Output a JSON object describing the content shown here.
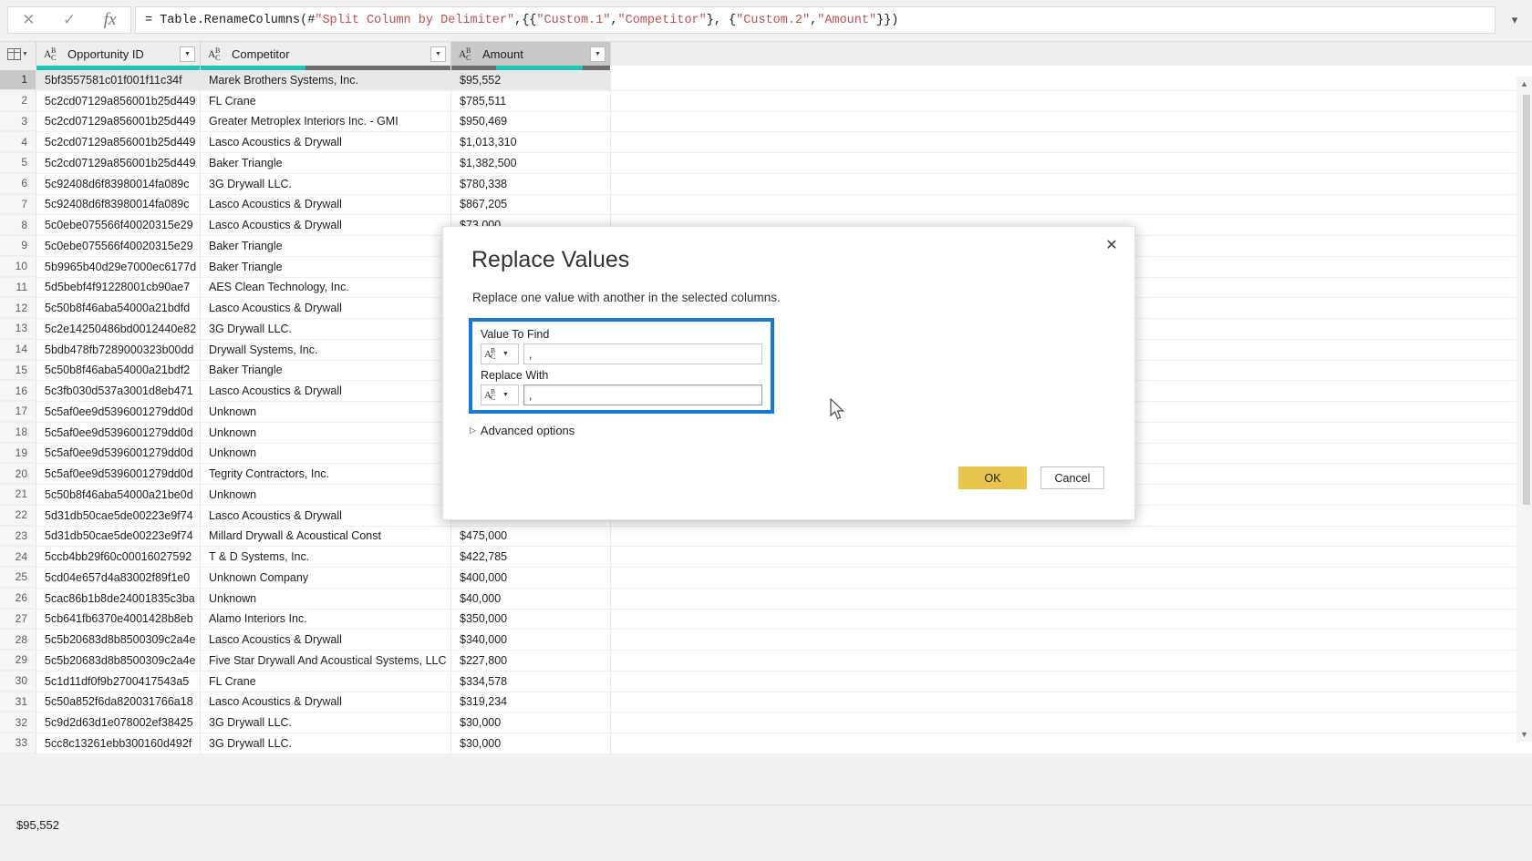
{
  "formula_bar": {
    "cancel_icon": "close-icon",
    "accept_icon": "check-icon",
    "fx_label": "fx",
    "formula_prefix": "= Table.RenameColumns(#",
    "formula_full": "= Table.RenameColumns(#\"Split Column by Delimiter\",{{\"Custom.1\", \"Competitor\"}, {\"Custom.2\", \"Amount\"}})",
    "seg_1": "= Table.RenameColumns(#",
    "seg_2": "\"Split Column by Delimiter\"",
    "seg_3": ",{{",
    "seg_4": "\"Custom.1\"",
    "seg_5": ", ",
    "seg_6": "\"Competitor\"",
    "seg_7": "}, {",
    "seg_8": "\"Custom.2\"",
    "seg_9": ", ",
    "seg_10": "\"Amount\"",
    "seg_11": "}})",
    "expand_icon": "chevron-down-icon"
  },
  "grid": {
    "columns": [
      {
        "name": "Opportunity ID",
        "type_icon": "abc-text-type-icon",
        "quality_ok_pct": 100,
        "selected": false
      },
      {
        "name": "Competitor",
        "type_icon": "abc-text-type-icon",
        "quality_ok_pct": 42,
        "selected": false
      },
      {
        "name": "Amount",
        "type_icon": "abc-text-type-icon",
        "quality_ok_pct": 55,
        "selected": true
      }
    ],
    "rows": [
      {
        "n": "1",
        "id": "5bf3557581c01f001f11c34f",
        "competitor": "Marek Brothers Systems, Inc.",
        "amount": "$95,552"
      },
      {
        "n": "2",
        "id": "5c2cd07129a856001b25d449",
        "competitor": "FL Crane",
        "amount": "$785,511"
      },
      {
        "n": "3",
        "id": "5c2cd07129a856001b25d449",
        "competitor": "Greater Metroplex Interiors  Inc. - GMI",
        "amount": "$950,469"
      },
      {
        "n": "4",
        "id": "5c2cd07129a856001b25d449",
        "competitor": "Lasco Acoustics & Drywall",
        "amount": "$1,013,310"
      },
      {
        "n": "5",
        "id": "5c2cd07129a856001b25d449",
        "competitor": "Baker Triangle",
        "amount": "$1,382,500"
      },
      {
        "n": "6",
        "id": "5c92408d6f83980014fa089c",
        "competitor": "3G Drywall LLC.",
        "amount": "$780,338"
      },
      {
        "n": "7",
        "id": "5c92408d6f83980014fa089c",
        "competitor": "Lasco Acoustics & Drywall",
        "amount": "$867,205"
      },
      {
        "n": "8",
        "id": "5c0ebe075566f40020315e29",
        "competitor": "Lasco Acoustics & Drywall",
        "amount": "$73.000"
      },
      {
        "n": "9",
        "id": "5c0ebe075566f40020315e29",
        "competitor": "Baker Triangle",
        "amount": ""
      },
      {
        "n": "10",
        "id": "5b9965b40d29e7000ec6177d",
        "competitor": "Baker Triangle",
        "amount": ""
      },
      {
        "n": "11",
        "id": "5d5bebf4f91228001cb90ae7",
        "competitor": "AES Clean Technology, Inc.",
        "amount": ""
      },
      {
        "n": "12",
        "id": "5c50b8f46aba54000a21bdfd",
        "competitor": "Lasco Acoustics & Drywall",
        "amount": ""
      },
      {
        "n": "13",
        "id": "5c2e14250486bd0012440e82",
        "competitor": "3G Drywall LLC.",
        "amount": ""
      },
      {
        "n": "14",
        "id": "5bdb478fb7289000323b00dd",
        "competitor": "Drywall Systems, Inc.",
        "amount": ""
      },
      {
        "n": "15",
        "id": "5c50b8f46aba54000a21bdf2",
        "competitor": "Baker Triangle",
        "amount": ""
      },
      {
        "n": "16",
        "id": "5c3fb030d537a3001d8eb471",
        "competitor": "Lasco Acoustics & Drywall",
        "amount": ""
      },
      {
        "n": "17",
        "id": "5c5af0ee9d5396001279dd0d",
        "competitor": "Unknown",
        "amount": ""
      },
      {
        "n": "18",
        "id": "5c5af0ee9d5396001279dd0d",
        "competitor": "Unknown",
        "amount": ""
      },
      {
        "n": "19",
        "id": "5c5af0ee9d5396001279dd0d",
        "competitor": "Unknown",
        "amount": ""
      },
      {
        "n": "20",
        "id": "5c5af0ee9d5396001279dd0d",
        "competitor": "Tegrity Contractors, Inc.",
        "amount": ""
      },
      {
        "n": "21",
        "id": "5c50b8f46aba54000a21be0d",
        "competitor": "Unknown",
        "amount": ""
      },
      {
        "n": "22",
        "id": "5d31db50cae5de00223e9f74",
        "competitor": "Lasco Acoustics & Drywall",
        "amount": ""
      },
      {
        "n": "23",
        "id": "5d31db50cae5de00223e9f74",
        "competitor": "Millard Drywall & Acoustical Const",
        "amount": "$475,000"
      },
      {
        "n": "24",
        "id": "5ccb4bb29f60c00016027592",
        "competitor": "T & D Systems, Inc.",
        "amount": "$422,785"
      },
      {
        "n": "25",
        "id": "5cd04e657d4a83002f89f1e0",
        "competitor": "Unknown Company",
        "amount": "$400,000"
      },
      {
        "n": "26",
        "id": "5cac86b1b8de24001835c3ba",
        "competitor": "Unknown",
        "amount": "$40,000"
      },
      {
        "n": "27",
        "id": "5cb641fb6370e4001428b8eb",
        "competitor": "Alamo Interiors Inc.",
        "amount": "$350,000"
      },
      {
        "n": "28",
        "id": "5c5b20683d8b8500309c2a4e",
        "competitor": "Lasco Acoustics & Drywall",
        "amount": "$340,000"
      },
      {
        "n": "29",
        "id": "5c5b20683d8b8500309c2a4e",
        "competitor": "Five Star Drywall And Acoustical Systems, LLC",
        "amount": "$227,800"
      },
      {
        "n": "30",
        "id": "5c1d11df0f9b2700417543a5",
        "competitor": "FL Crane",
        "amount": "$334,578"
      },
      {
        "n": "31",
        "id": "5c50a852f6da820031766a18",
        "competitor": "Lasco Acoustics & Drywall",
        "amount": "$319,234"
      },
      {
        "n": "32",
        "id": "5c9d2d63d1e078002ef38425",
        "competitor": "3G Drywall LLC.",
        "amount": "$30,000"
      },
      {
        "n": "33",
        "id": "5cc8c13261ebb300160d492f",
        "competitor": "3G Drywall LLC.",
        "amount": "$30,000"
      }
    ]
  },
  "dialog": {
    "title": "Replace Values",
    "subtitle": "Replace one value with another in the selected columns.",
    "close_icon": "close-icon",
    "value_to_find_label": "Value To Find",
    "value_to_find_value": ",",
    "value_to_find_type": "abc-text-type-icon",
    "replace_with_label": "Replace With",
    "replace_with_value": ",",
    "replace_with_type": "abc-text-type-icon",
    "advanced_options_label": "Advanced options",
    "advanced_options_icon": "triangle-right-icon",
    "ok_label": "OK",
    "cancel_label": "Cancel",
    "highlight_color": "#1878d0",
    "ok_color": "#e8c54a"
  },
  "status_bar": {
    "preview_value": "$95,552"
  },
  "scrollbar": {
    "up_icon": "chevron-up-icon",
    "down_icon": "chevron-down-icon"
  }
}
